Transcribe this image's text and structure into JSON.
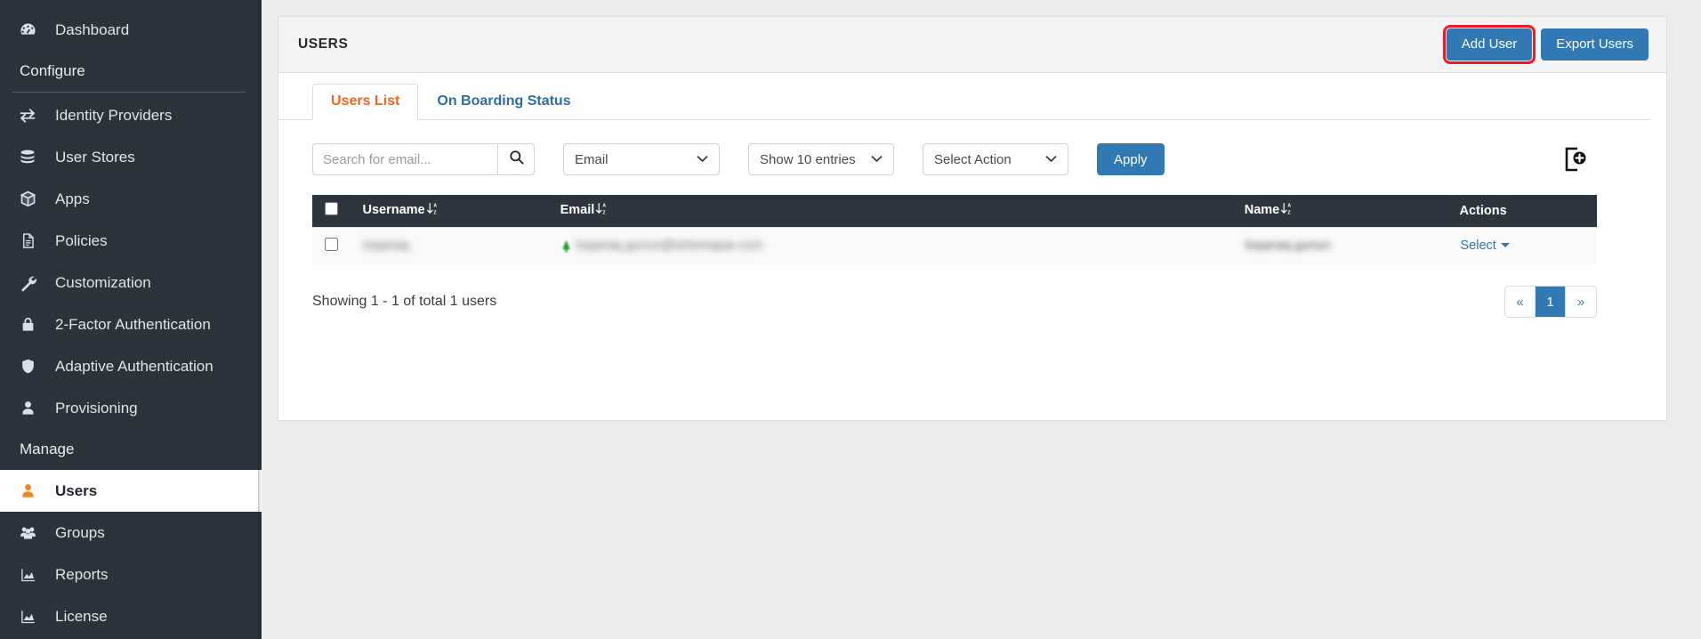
{
  "sidebar": {
    "items": [
      {
        "label": "Dashboard",
        "icon": "dashboard-icon",
        "type": "item",
        "active": false
      },
      {
        "label": "Configure",
        "icon": "",
        "type": "section"
      },
      {
        "label": "Identity Providers",
        "icon": "identity-providers-icon",
        "type": "item",
        "active": false
      },
      {
        "label": "User Stores",
        "icon": "database-icon",
        "type": "item",
        "active": false
      },
      {
        "label": "Apps",
        "icon": "cube-icon",
        "type": "item",
        "active": false
      },
      {
        "label": "Policies",
        "icon": "document-icon",
        "type": "item",
        "active": false
      },
      {
        "label": "Customization",
        "icon": "wrench-icon",
        "type": "item",
        "active": false
      },
      {
        "label": "2-Factor Authentication",
        "icon": "lock-icon",
        "type": "item",
        "active": false
      },
      {
        "label": "Adaptive Authentication",
        "icon": "shield-icon",
        "type": "item",
        "active": false
      },
      {
        "label": "Provisioning",
        "icon": "user-icon",
        "type": "item",
        "active": false
      },
      {
        "label": "Manage",
        "icon": "",
        "type": "section"
      },
      {
        "label": "Users",
        "icon": "user-icon",
        "type": "item",
        "active": true
      },
      {
        "label": "Groups",
        "icon": "users-group-icon",
        "type": "item",
        "active": false
      },
      {
        "label": "Reports",
        "icon": "chart-icon",
        "type": "item",
        "active": false
      },
      {
        "label": "License",
        "icon": "chart-icon",
        "type": "item",
        "active": false
      }
    ]
  },
  "card": {
    "title": "USERS",
    "add_user_label": "Add User",
    "export_users_label": "Export Users",
    "highlight_color": "#ee1b24",
    "primary_color": "#3079b5"
  },
  "tabs": [
    {
      "label": "Users List",
      "active": true
    },
    {
      "label": "On Boarding Status",
      "active": false
    }
  ],
  "toolbar": {
    "search_placeholder": "Search for email...",
    "search_value": "",
    "search_icon": "search-icon",
    "filter_field": "Email",
    "entries_select": "Show 10 entries",
    "action_select": "Select Action",
    "apply_label": "Apply",
    "import_icon": "import-user-icon"
  },
  "table": {
    "columns": [
      {
        "key": "check",
        "label": ""
      },
      {
        "key": "username",
        "label": "Username",
        "sortable": true
      },
      {
        "key": "email",
        "label": "Email",
        "sortable": true
      },
      {
        "key": "name",
        "label": "Name",
        "sortable": true
      },
      {
        "key": "actions",
        "label": "Actions",
        "sortable": false
      }
    ],
    "rows": [
      {
        "username": "loqanaq",
        "email": "loqanaq.gunun@sirtomapar.com",
        "name": "loqanaq.gunun",
        "action_label": "Select",
        "blurred": true
      }
    ]
  },
  "footer": {
    "showing_text": "Showing 1 - 1 of total 1 users",
    "pagination": [
      {
        "label": "«",
        "active": false
      },
      {
        "label": "1",
        "active": true
      },
      {
        "label": "»",
        "active": false
      }
    ]
  }
}
